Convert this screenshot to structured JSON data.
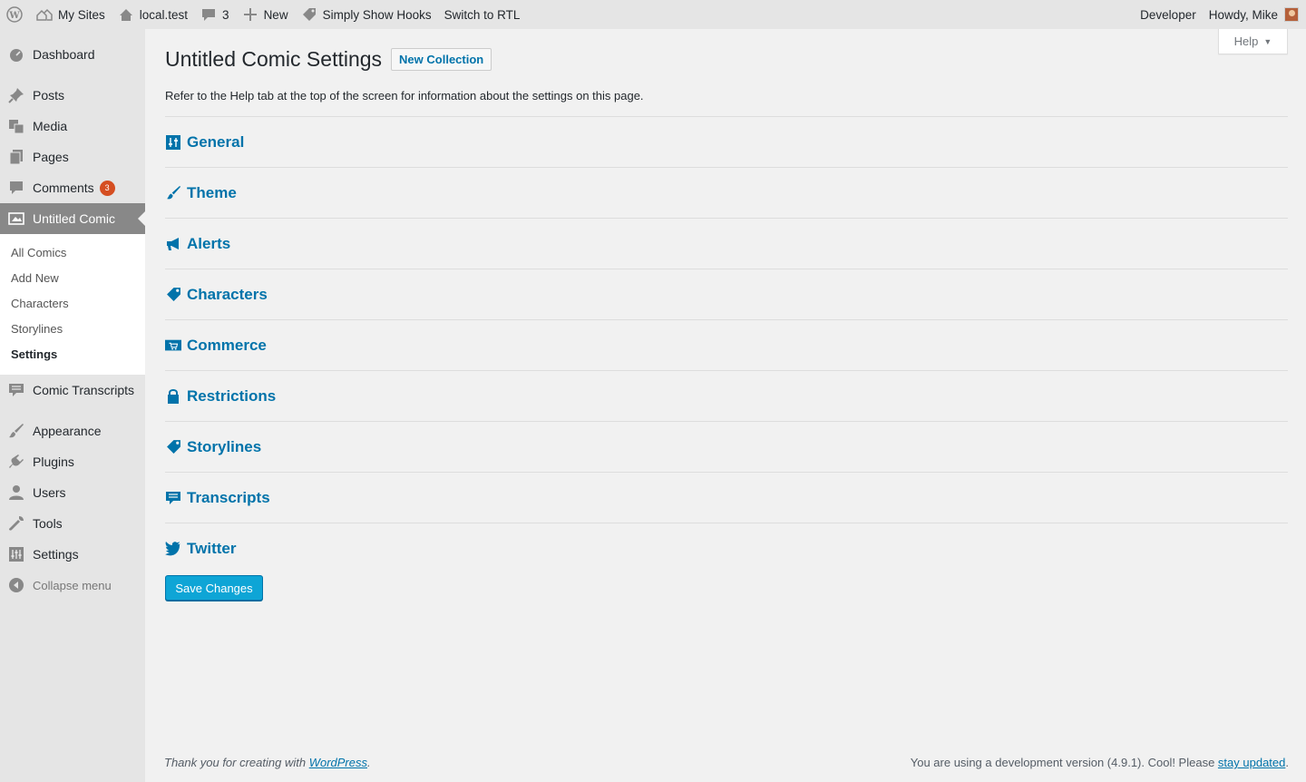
{
  "adminbar": {
    "my_sites": "My Sites",
    "site_name": "local.test",
    "comments_count": "3",
    "new_label": "New",
    "simply_show_hooks": "Simply Show Hooks",
    "switch_rtl": "Switch to RTL",
    "developer": "Developer",
    "howdy": "Howdy, Mike"
  },
  "sidebar": {
    "dashboard": "Dashboard",
    "posts": "Posts",
    "media": "Media",
    "pages": "Pages",
    "comments": "Comments",
    "comments_badge": "3",
    "untitled_comic": "Untitled Comic",
    "sub": [
      "All Comics",
      "Add New",
      "Characters",
      "Storylines",
      "Settings"
    ],
    "comic_transcripts": "Comic Transcripts",
    "appearance": "Appearance",
    "plugins": "Plugins",
    "users": "Users",
    "tools": "Tools",
    "settings": "Settings",
    "collapse": "Collapse menu"
  },
  "main": {
    "help": "Help",
    "title": "Untitled Comic Settings",
    "new_collection": "New Collection",
    "intro": "Refer to the Help tab at the top of the screen for information about the settings on this page.",
    "sections": [
      "General",
      "Theme",
      "Alerts",
      "Characters",
      "Commerce",
      "Restrictions",
      "Storylines",
      "Transcripts",
      "Twitter"
    ],
    "save": "Save Changes"
  },
  "footer": {
    "thanks_prefix": "Thank you for creating with ",
    "thanks_link": "WordPress",
    "thanks_suffix": ".",
    "version_prefix": "You are using a development version (4.9.1). Cool! Please ",
    "version_link": "stay updated",
    "version_suffix": "."
  },
  "colors": {
    "link": "#0073aa",
    "current_menu": "#888888",
    "badge": "#d54e21",
    "primary_button": "#0ea5d6"
  }
}
